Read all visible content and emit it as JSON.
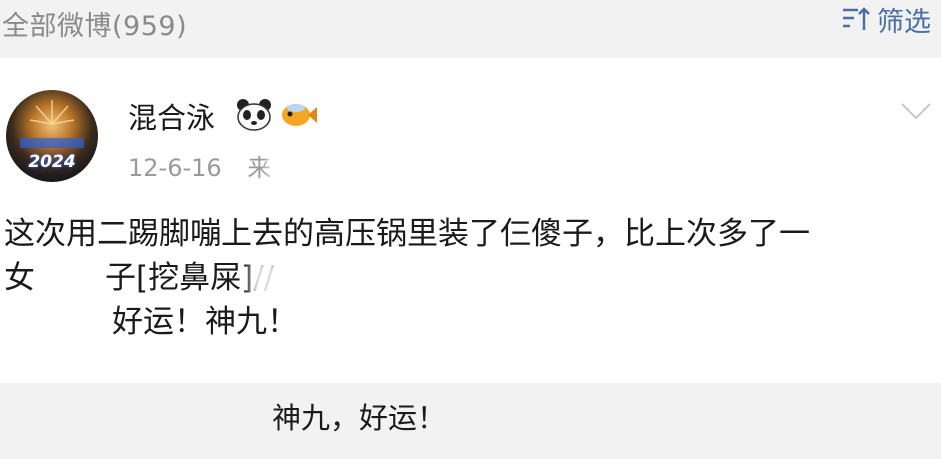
{
  "header": {
    "count_label": "全部微博(959)",
    "filter_label": "筛选",
    "filter_icon": "sort-filter-icon"
  },
  "post": {
    "avatar_text": "2024",
    "username": "混合泳",
    "emoji_1": "panda-emoji-icon",
    "emoji_2": "fish-emoji-icon",
    "date": "12-6-16",
    "source_prefix": "来",
    "chevron_icon": "chevron-down-icon",
    "line1": "这次用二踢脚嘣上去的高压锅里装了仨傻子，比上次多了一",
    "line2": "女",
    "line2_tag": "子[挖鼻屎]//",
    "line3": "好运！神九！"
  },
  "repost": {
    "text": "神九，好运！"
  },
  "colors": {
    "link": "#4a6fa5",
    "header_bg": "#f2f2f2"
  }
}
